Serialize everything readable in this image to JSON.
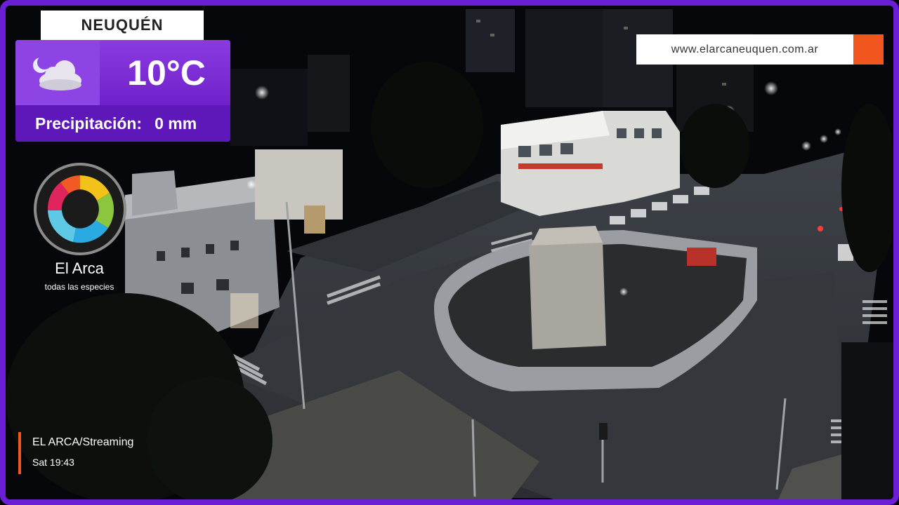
{
  "location": {
    "city": "NEUQUÉN"
  },
  "weather": {
    "condition_icon": "moon-cloud-icon",
    "temperature": "10°C",
    "precip_label": "Precipitación:",
    "precip_value": "0 mm"
  },
  "brand": {
    "name": "El Arca",
    "tagline": "todas las especies",
    "url": "www.elarcaneuquen.com.ar",
    "accent_color": "#f0561e",
    "frame_color": "#6a1fd6"
  },
  "stream": {
    "title": "EL ARCA/Streaming",
    "timestamp": "Sat 19:43"
  }
}
